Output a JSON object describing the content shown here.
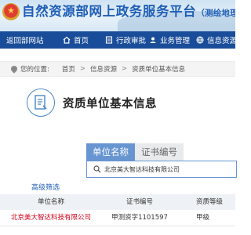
{
  "header": {
    "title": "自然资源部网上政务服务平台",
    "subtitle": "（测绘地理信息）"
  },
  "nav": {
    "back": "返回部网站",
    "home": "首页",
    "admin": "行政审批",
    "business": "业务管理",
    "info": "信息资源"
  },
  "breadcrumb": {
    "prefix": "您的位置:",
    "items": [
      "首页",
      "信息资源",
      "资质单位基本信息"
    ],
    "separator": ">"
  },
  "panel": {
    "title": "资质单位基本信息"
  },
  "search": {
    "tabs": [
      "单位名称",
      "证书编号"
    ],
    "active_tab": "单位名称",
    "value": "北京美大智达科技有限公司",
    "advanced_filter": "高级筛选"
  },
  "table": {
    "headers": [
      "单位名称",
      "证书编号",
      "资质等级"
    ],
    "rows": [
      {
        "name": "北京美大智达科技有限公司",
        "cert": "甲测资字1101597",
        "level": "甲级"
      }
    ]
  },
  "colors": {
    "brand_blue": "#1a4d99",
    "title_blue": "#1f5eb6",
    "tab_active": "#6795d1",
    "link_red": "#d0021b"
  }
}
